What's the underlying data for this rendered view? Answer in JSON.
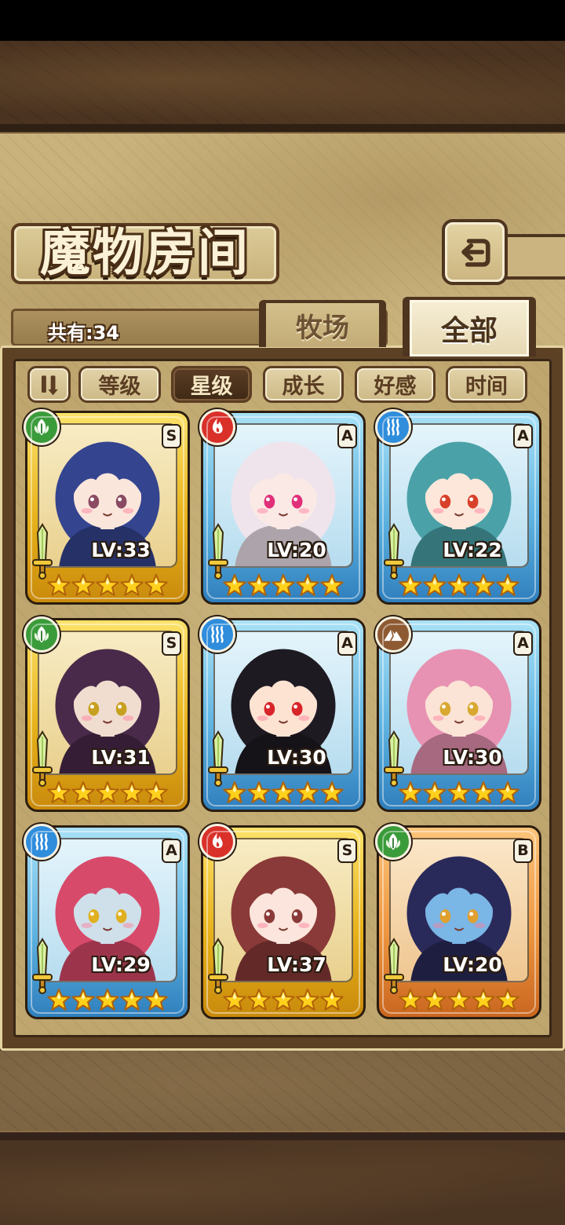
{
  "header": {
    "title": "魔物房间",
    "back_icon": "back-arrow-icon"
  },
  "summary": {
    "count_label": "共有:34"
  },
  "tabs": [
    {
      "label": "牧场",
      "selected": false
    },
    {
      "label": "全部",
      "selected": true
    }
  ],
  "sort": {
    "order_icon": "sort-order-icon",
    "options": [
      {
        "label": "等级",
        "selected": false
      },
      {
        "label": "星级",
        "selected": true
      },
      {
        "label": "成长",
        "selected": false
      },
      {
        "label": "好感",
        "selected": false
      },
      {
        "label": "时间",
        "selected": false
      }
    ]
  },
  "element_colors": {
    "nature": "#3a9b3a",
    "fire": "#d9302a",
    "water": "#2f8ddc",
    "earth": "#8e5a32"
  },
  "monsters": [
    {
      "element": "nature",
      "rank": "S",
      "frame": "gold",
      "level": "LV:33",
      "stars": 5,
      "hair": "#34448f",
      "skin": "#fbe6dc",
      "eyes": "#8a4a62"
    },
    {
      "element": "fire",
      "rank": "A",
      "frame": "blue",
      "level": "LV:20",
      "stars": 5,
      "hair": "#efe4ec",
      "skin": "#fbe9e6",
      "eyes": "#e0307a"
    },
    {
      "element": "water",
      "rank": "A",
      "frame": "blue",
      "level": "LV:22",
      "stars": 5,
      "hair": "#4aa2a8",
      "skin": "#fde7da",
      "eyes": "#d8402a"
    },
    {
      "element": "nature",
      "rank": "S",
      "frame": "gold",
      "level": "LV:31",
      "stars": 5,
      "hair": "#4a2a4a",
      "skin": "#f0ddd0",
      "eyes": "#c8a020"
    },
    {
      "element": "water",
      "rank": "A",
      "frame": "blue",
      "level": "LV:30",
      "stars": 5,
      "hair": "#1e1a22",
      "skin": "#fde3d2",
      "eyes": "#d8252a"
    },
    {
      "element": "earth",
      "rank": "A",
      "frame": "blue",
      "level": "LV:30",
      "stars": 5,
      "hair": "#e792b2",
      "skin": "#fbe3d6",
      "eyes": "#d8a830"
    },
    {
      "element": "water",
      "rank": "A",
      "frame": "blue",
      "level": "LV:29",
      "stars": 5,
      "hair": "#d84a6a",
      "skin": "#cfe0ea",
      "eyes": "#e0b020"
    },
    {
      "element": "fire",
      "rank": "S",
      "frame": "gold",
      "level": "LV:37",
      "stars": 5,
      "hair": "#8a3a38",
      "skin": "#fbe5dc",
      "eyes": "#8a3a38"
    },
    {
      "element": "nature",
      "rank": "B",
      "frame": "orange",
      "level": "LV:20",
      "stars": 5,
      "hair": "#2a2a5a",
      "skin": "#7ab6e6",
      "eyes": "#e0a030"
    }
  ]
}
